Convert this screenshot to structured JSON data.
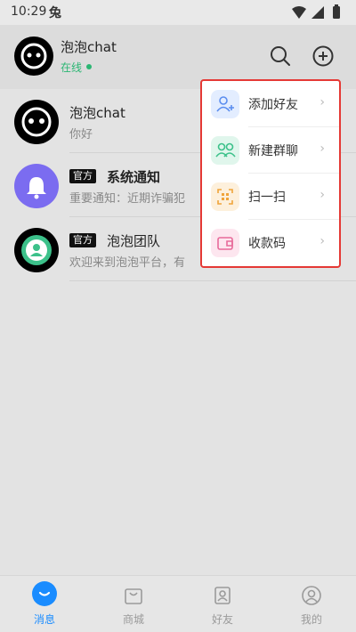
{
  "status_bar": {
    "time": "10:29",
    "app_glyph": "兔"
  },
  "header": {
    "name": "泡泡chat",
    "status": "在线",
    "search_icon": "search-icon",
    "add_icon": "add-circle-icon"
  },
  "conversations": [
    {
      "title": "泡泡chat",
      "message": "你好",
      "badge": "",
      "avatar": "bubble-face-avatar"
    },
    {
      "title": "系统通知",
      "message": "重要通知：近期诈骗犯",
      "badge": "官方",
      "avatar": "bell-avatar"
    },
    {
      "title": "泡泡团队",
      "message": "欢迎来到泡泡平台，有",
      "badge": "官方",
      "avatar": "person-avatar"
    }
  ],
  "popup_menu": {
    "items": [
      {
        "label": "添加好友",
        "icon": "add-friend-icon",
        "color": "#5b8def",
        "bg": "#e3edff"
      },
      {
        "label": "新建群聊",
        "icon": "group-chat-icon",
        "color": "#3cc18a",
        "bg": "#e0f6ec"
      },
      {
        "label": "扫一扫",
        "icon": "scan-icon",
        "color": "#f0a43a",
        "bg": "#fdf0dc"
      },
      {
        "label": "收款码",
        "icon": "wallet-icon",
        "color": "#e86a9a",
        "bg": "#fde6ef"
      }
    ],
    "chevron": "›"
  },
  "tabs": [
    {
      "label": "消息",
      "active": true
    },
    {
      "label": "商城",
      "active": false
    },
    {
      "label": "好友",
      "active": false
    },
    {
      "label": "我的",
      "active": false
    }
  ],
  "colors": {
    "accent": "#1a8cff",
    "online": "#2bb673",
    "highlight_border": "#e53935"
  }
}
